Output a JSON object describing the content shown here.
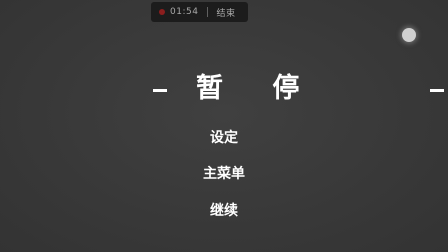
{
  "recorder": {
    "time": "01:54",
    "stop_label": "结束",
    "dot_color": "#8c1e1e"
  },
  "pause_menu": {
    "title": "暂 停",
    "items": [
      {
        "label": "设定"
      },
      {
        "label": "主菜单"
      },
      {
        "label": "继续"
      }
    ]
  },
  "colors": {
    "background": "#3b3b3b",
    "text": "#ffffff"
  }
}
